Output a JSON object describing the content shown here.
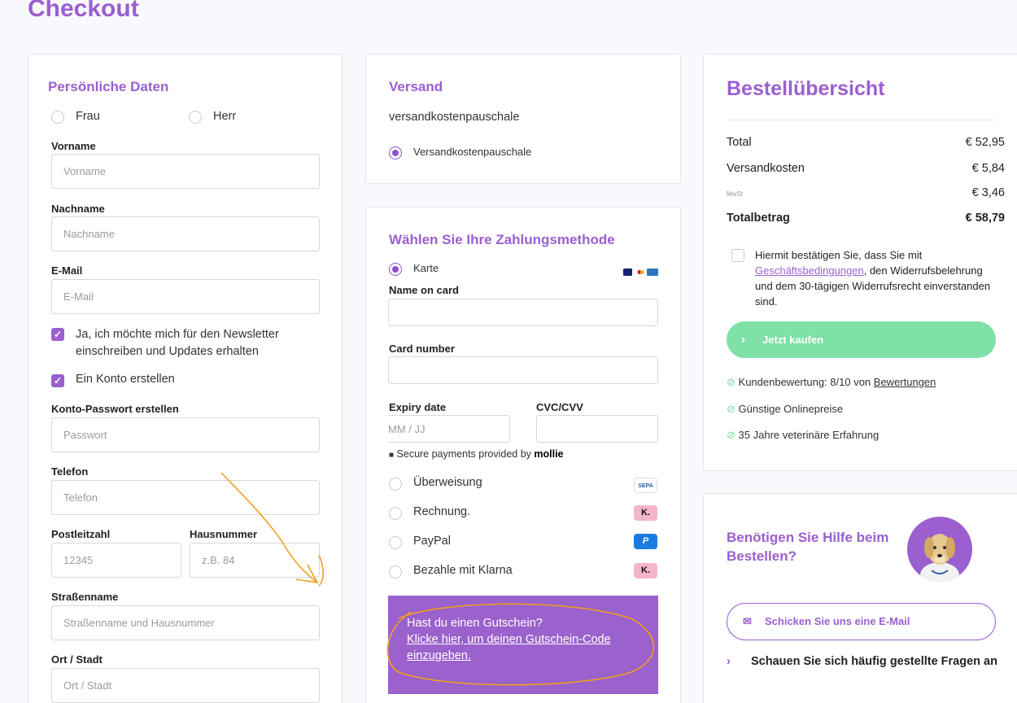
{
  "page_title": "Checkout",
  "personal": {
    "title": "Persönliche Daten",
    "salutation": [
      "Frau",
      "Herr"
    ],
    "first_name": {
      "label": "Vorname",
      "placeholder": "Vorname"
    },
    "last_name": {
      "label": "Nachname",
      "placeholder": "Nachname"
    },
    "email": {
      "label": "E-Mail",
      "placeholder": "E-Mail"
    },
    "newsletter": "Ja, ich möchte mich für den Newsletter einschreiben und Updates erhalten",
    "create_account": "Ein Konto erstellen",
    "password": {
      "label": "Konto-Passwort erstellen",
      "placeholder": "Passwort"
    },
    "phone": {
      "label": "Telefon",
      "placeholder": "Telefon"
    },
    "zip": {
      "label": "Postleitzahl",
      "placeholder": "12345"
    },
    "house_no": {
      "label": "Hausnummer",
      "placeholder": "z.B. 84"
    },
    "street": {
      "label": "Straßenname",
      "placeholder": "Straßenname und Hausnummer"
    },
    "city": {
      "label": "Ort / Stadt",
      "placeholder": "Ort / Stadt"
    }
  },
  "shipping": {
    "title": "Versand",
    "subtitle": "versandkostenpauschale",
    "option": "Versandkostenpauschale"
  },
  "payment": {
    "title": "Wählen Sie Ihre Zahlungsmethode",
    "card_label": "Karte",
    "name_on_card": "Name on card",
    "card_number": "Card number",
    "expiry": "Expiry date",
    "expiry_placeholder": "MM / JJ",
    "cvc": "CVC/CVV",
    "secure_text": "Secure payments provided by",
    "secure_brand": "mollie",
    "methods": [
      {
        "label": "Überweisung",
        "icon": "sepa-icon",
        "badge": "SEPA"
      },
      {
        "label": "Rechnung.",
        "icon": "klarna-icon",
        "badge": "K."
      },
      {
        "label": "PayPal",
        "icon": "paypal-icon",
        "badge": "P"
      },
      {
        "label": "Bezahle mit Klarna",
        "icon": "klarna-icon",
        "badge": "K."
      }
    ],
    "voucher_question": "Hast du einen Gutschein?",
    "voucher_link": "Klicke hier, um deinen Gutschein-Code einzugeben."
  },
  "summary": {
    "title": "Bestellübersicht",
    "rows": [
      {
        "label": "Total",
        "value": "€ 52,95"
      },
      {
        "label": "Versandkosten",
        "value": "€ 5,84"
      },
      {
        "label": "MwSt",
        "value": "€ 3,46"
      },
      {
        "label": "Totalbetrag",
        "value": "€ 58,79"
      }
    ],
    "terms_pre": "Hiermit bestätigen Sie, dass Sie mit",
    "terms_link": "Geschäftsbedingungen",
    "terms_post": ", den Widerrufsbelehrung und dem 30-tägigen Widerrufsrecht einverstanden sind.",
    "buy_button": "Jetzt kaufen",
    "trust": [
      {
        "text": "Kundenbewertung: 8/10 von ",
        "link": "Bewertungen"
      },
      {
        "text": "Günstige Onlinepreise",
        "link": ""
      },
      {
        "text": "35 Jahre veterinäre Erfahrung",
        "link": ""
      }
    ]
  },
  "help": {
    "title": "Benötigen Sie Hilfe beim Bestellen?",
    "mail_button": "Schicken Sie uns eine E-Mail",
    "faq": "Schauen Sie sich häufig gestellte Fragen an"
  },
  "colors": {
    "accent": "#9b5fcf",
    "buy": "#7fe0a8",
    "annotation": "#f0a020"
  }
}
